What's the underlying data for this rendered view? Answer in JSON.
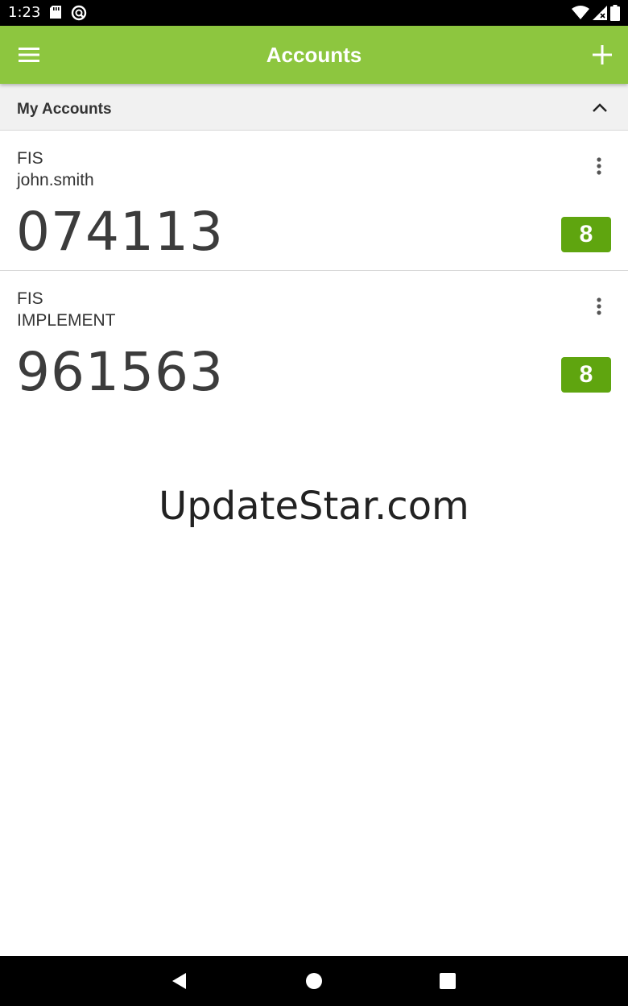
{
  "status_bar": {
    "time": "1:23"
  },
  "app_bar": {
    "title": "Accounts",
    "menu_icon": "hamburger-menu-icon",
    "add_icon": "plus-icon"
  },
  "section": {
    "title": "My Accounts",
    "collapse_icon": "chevron-up-icon"
  },
  "accounts": [
    {
      "issuer": "FIS",
      "username": "john.smith",
      "code": "074113",
      "timer": "8"
    },
    {
      "issuer": "FIS",
      "username": "IMPLEMENT",
      "code": "961563",
      "timer": "8"
    }
  ],
  "watermark": "UpdateStar.com",
  "colors": {
    "app_bar": "#8dc63f",
    "timer_badge": "#5fa50f",
    "section_bg": "#f1f1f1"
  }
}
